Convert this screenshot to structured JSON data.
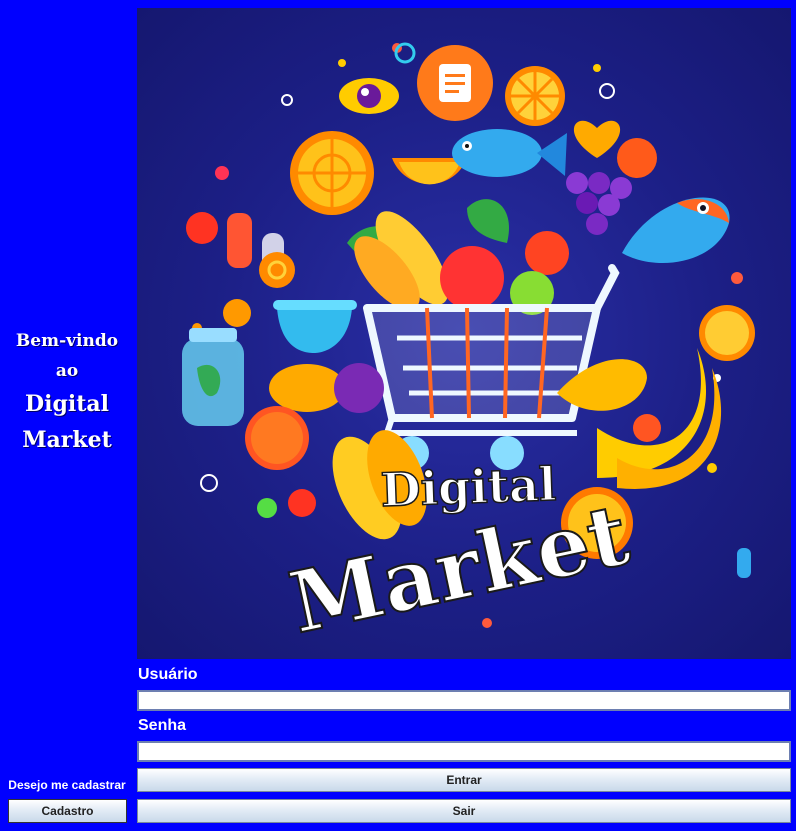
{
  "welcome": {
    "line1": "Bem-vindo",
    "line2": "ao",
    "line3": "Digital",
    "line4": "Market"
  },
  "hero": {
    "title_word1": "Digital",
    "title_word2": "Market"
  },
  "login": {
    "username_label": "Usuário",
    "username_value": "",
    "password_label": "Senha",
    "password_value": "",
    "enter_button": "Entrar",
    "exit_button": "Sair"
  },
  "signup": {
    "prompt": "Desejo me cadastrar",
    "button": "Cadastro"
  },
  "colors": {
    "background": "#0000ff",
    "hero_background": "#1c1f86",
    "button_gradient_top": "#ffffff",
    "button_gradient_bottom": "#c9d9ea"
  }
}
